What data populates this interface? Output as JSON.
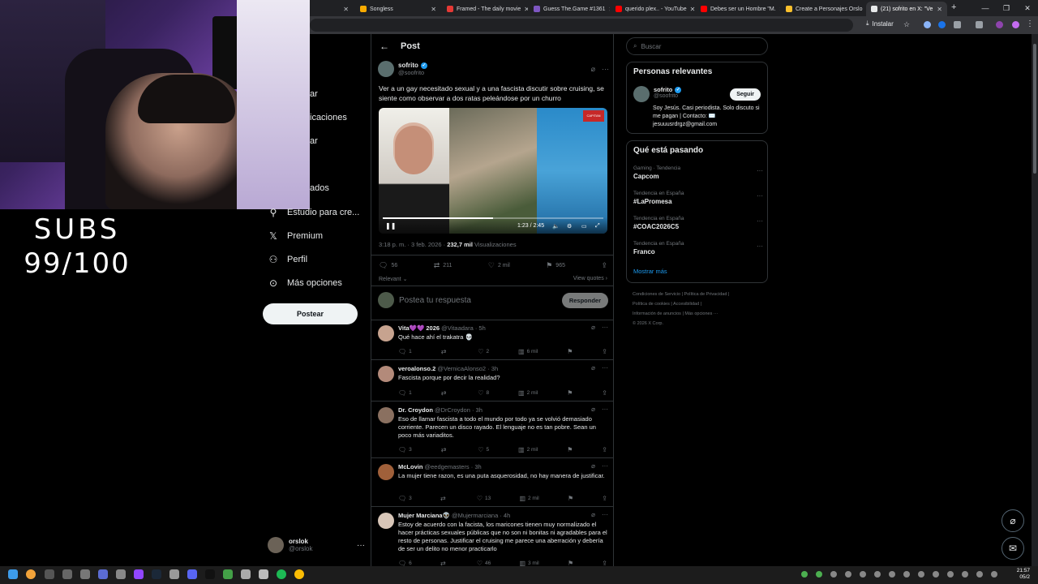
{
  "browser": {
    "tabs": [
      {
        "label": "r",
        "color": "#5f6368"
      },
      {
        "label": "Songless",
        "color": "#f9ab00"
      },
      {
        "label": "Framed - The daily movie",
        "color": "#e53935"
      },
      {
        "label": "Guess The.Game #1361",
        "color": "#7e57c2"
      },
      {
        "label": "querido plex.. - YouTube",
        "color": "#ff0000"
      },
      {
        "label": "Debes ser un Hombre \"M.",
        "color": "#ff0000"
      },
      {
        "label": "Create a Personajes Orslo",
        "color": "#fbc02d"
      },
      {
        "label": "(21) sofrito en X: \"Ve",
        "color": "#e7e9ea"
      }
    ],
    "install_label": "Instalar"
  },
  "overlay": {
    "subs_label": "SUBS",
    "subs_count": "99/100"
  },
  "nav": {
    "partial_items": [
      "ar",
      "icaciones",
      "ar",
      "ados"
    ],
    "items": [
      {
        "label": "Estudio para cre...",
        "icon": "studio-icon"
      },
      {
        "label": "Premium",
        "icon": "x-logo-icon"
      },
      {
        "label": "Perfil",
        "icon": "person-icon"
      },
      {
        "label": "Más opciones",
        "icon": "more-circle-icon"
      }
    ],
    "post_button": "Postear",
    "account": {
      "name": "orslok",
      "handle": "@orslok"
    }
  },
  "post": {
    "header_title": "Post",
    "author_name": "sofrito",
    "author_handle": "@soofrito",
    "text": "Ver a un gay necesitado sexual y a una fascista discutir sobre cruising, se siente como observar a dos ratas peleándose por un churro",
    "video": {
      "time": "1:23 / 2:45",
      "progress": 0.5,
      "channel_badge": "CAPITAN"
    },
    "timestamp": "3:18 p. m. · 3 feb. 2026 · ",
    "views": "232,7 mil",
    "views_label": " Visualizaciones",
    "replies": "56",
    "reposts": "211",
    "likes": "2 mil",
    "bookmarks": "965",
    "sort_label": "Relevant",
    "quotes_label": "View quotes",
    "reply_placeholder": "Postea tu respuesta",
    "reply_button": "Responder"
  },
  "replies": [
    {
      "name": "Vita💜💜 2026",
      "handle": "@Vitaadara · 5h",
      "text": "Qué hace ahí el trakatra 💀",
      "replies": "1",
      "reposts": "",
      "likes": "2",
      "views": "6 mil",
      "avatar_color": "#c7a38f"
    },
    {
      "name": "veroalonso.2",
      "handle": "@VernicaAlonso2 · 3h",
      "text": "Fascista porque por decir la realidad?",
      "replies": "1",
      "reposts": "",
      "likes": "8",
      "views": "2 mil",
      "avatar_color": "#b38a7a"
    },
    {
      "name": "Dr. Croydon",
      "handle": "@DrCroydon · 3h",
      "text": "Eso de llamar fascista a todo el mundo por todo ya se volvió demasiado corriente. Parecen un disco rayado. El lenguaje no es tan pobre. Sean un poco más variaditos.",
      "replies": "3",
      "reposts": "",
      "likes": "5",
      "views": "2 mil",
      "avatar_color": "#8a7060"
    },
    {
      "name": "McLovin",
      "handle": "@eedgemasters · 3h",
      "text": "La mujer tiene razon, es una puta asquerosidad, no hay manera de justificar.",
      "replies": "3",
      "reposts": "",
      "likes": "13",
      "views": "2 mil",
      "avatar_color": "#a0603a"
    },
    {
      "name": "Mujer Marciana👽",
      "handle": "@Mujermarciana · 4h",
      "text": "Estoy de acuerdo con la facista, los maricones tienen muy normalizado el hacer prácticas sexuales públicas que no son ni bonitas ni agradables para el resto de personas. Justificar el cruising me parece una aberración y debería de ser un delito no menor practicarlo",
      "replies": "6",
      "reposts": "",
      "likes": "46",
      "views": "3 mil",
      "avatar_color": "#d8c6b8"
    }
  ],
  "right": {
    "search_placeholder": "Buscar",
    "relevant_title": "Personas relevantes",
    "relevant_name": "sofrito",
    "relevant_handle": "@soofrito",
    "relevant_bio": "Soy Jesús. Casi periodista. Solo discuto si me pagan | Contacto: ✉️ jesuuusrdrgz@gmail.com",
    "follow_button": "Seguir",
    "trending_title": "Qué está pasando",
    "trends": [
      {
        "context": "Gaming · Tendencia",
        "name": "Capcom"
      },
      {
        "context": "Tendencia en España",
        "name": "#LaPromesa"
      },
      {
        "context": "Tendencia en España",
        "name": "#COAC2026C5"
      },
      {
        "context": "Tendencia en España",
        "name": "Franco"
      }
    ],
    "show_more": "Mostrar más",
    "footer_lines": [
      "Condiciones de Servicio  |  Política de Privacidad  |",
      "Política de cookies  |  Accesibilidad  |",
      "Información de anuncios  |  Más opciones ···",
      "© 2026 X Corp."
    ]
  },
  "taskbar": {
    "time": "21:57",
    "date": "05/2"
  },
  "colors": {
    "accent": "#1d9bf0",
    "background": "#000000",
    "border": "#2f3336",
    "muted": "#71767b"
  }
}
